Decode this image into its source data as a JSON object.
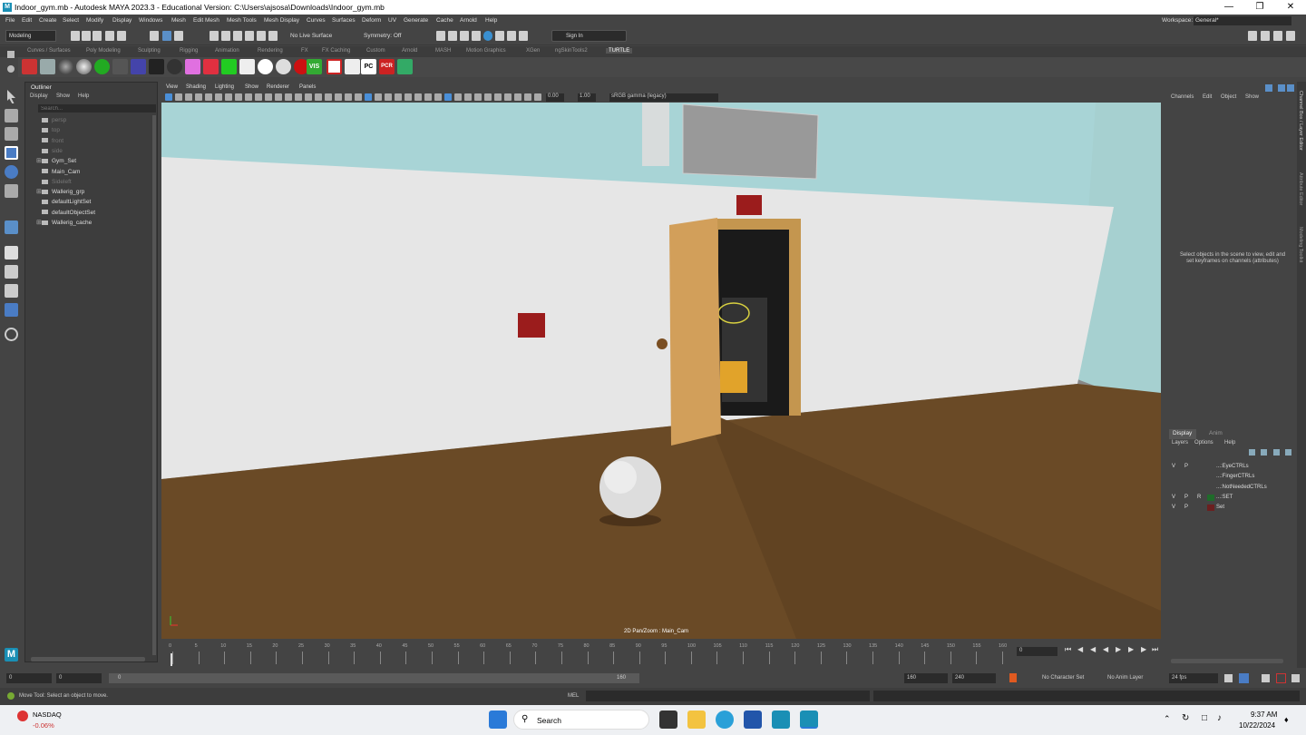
{
  "window": {
    "title": "Indoor_gym.mb - Autodesk MAYA 2023.3 - Educational Version: C:\\Users\\ajsosa\\Downloads\\Indoor_gym.mb"
  },
  "menu": [
    "File",
    "Edit",
    "Create",
    "Select",
    "Modify",
    "Display",
    "Windows",
    "Mesh",
    "Edit Mesh",
    "Mesh Tools",
    "Mesh Display",
    "Curves",
    "Surfaces",
    "Deform",
    "UV",
    "Generate",
    "Cache",
    "Arnold",
    "Help"
  ],
  "workspace": {
    "label": "Workspace:",
    "value": "General*"
  },
  "status": {
    "mode": "Modeling",
    "live_surface": "No Live Surface",
    "symmetry": "Symmetry: Off",
    "sign_in": "Sign In"
  },
  "shelf_tabs": [
    "Curves / Surfaces",
    "Poly Modeling",
    "Sculpting",
    "Rigging",
    "Animation",
    "Rendering",
    "FX",
    "FX Caching",
    "Custom",
    "Arnold",
    "MASH",
    "Motion Graphics",
    "XGen",
    "ngSkinTools2",
    "TURTLE"
  ],
  "shelf_text": {
    "vis": "VIS",
    "pc": "PC",
    "pcr": "PCR"
  },
  "outliner": {
    "title": "Outliner",
    "menus": [
      "Display",
      "Show",
      "Help"
    ],
    "search_placeholder": "Search...",
    "items": [
      {
        "label": "persp",
        "dim": true,
        "expand": false
      },
      {
        "label": "top",
        "dim": true,
        "expand": false
      },
      {
        "label": "front",
        "dim": true,
        "expand": false
      },
      {
        "label": "side",
        "dim": true,
        "expand": false
      },
      {
        "label": "Gym_Set",
        "dim": false,
        "expand": true
      },
      {
        "label": "Main_Cam",
        "dim": false,
        "expand": false
      },
      {
        "label": "Sideleft",
        "dim": true,
        "expand": false
      },
      {
        "label": "Wallerig_grp",
        "dim": false,
        "expand": true
      },
      {
        "label": "defaultLightSet",
        "dim": false,
        "expand": false
      },
      {
        "label": "defaultObjectSet",
        "dim": false,
        "expand": false
      },
      {
        "label": "Wallerig_cache",
        "dim": false,
        "expand": true
      }
    ]
  },
  "viewport": {
    "menus": [
      "View",
      "Shading",
      "Lighting",
      "Show",
      "Renderer",
      "Panels"
    ],
    "exposure": "0.00",
    "gamma": "1.00",
    "colorspace": "sRGB gamma (legacy)",
    "hud": "2D Pan/Zoom : Main_Cam"
  },
  "channel_box": {
    "menus": [
      "Channels",
      "Edit",
      "Object",
      "Show"
    ],
    "hint": "Select objects in the scene to view, edit and set keyframes on channels (attributes)"
  },
  "right_tabs": [
    "Channel Box / Layer Editor",
    "Attribute Editor",
    "Modeling Toolkit"
  ],
  "layers": {
    "tabs": [
      "Display",
      "Anim"
    ],
    "menus": [
      "Layers",
      "Options",
      "Help"
    ],
    "rows": [
      {
        "v": "V",
        "p": "P",
        "r": "",
        "name": "...:EyeCTRLs",
        "color": ""
      },
      {
        "v": "",
        "p": "",
        "r": "",
        "name": "...:FingerCTRLs",
        "color": ""
      },
      {
        "v": "",
        "p": "",
        "r": "",
        "name": "...:NotNeededCTRLs",
        "color": ""
      },
      {
        "v": "V",
        "p": "P",
        "r": "R",
        "name": "...:SET",
        "color": "#1f6b2a"
      },
      {
        "v": "V",
        "p": "P",
        "r": "",
        "name": "Set",
        "color": "#6b1f1f"
      }
    ]
  },
  "timeline": {
    "ticks": [
      "0",
      "5",
      "10",
      "15",
      "20",
      "25",
      "30",
      "35",
      "40",
      "45",
      "50",
      "55",
      "60",
      "65",
      "70",
      "75",
      "80",
      "85",
      "90",
      "95",
      "100",
      "105",
      "110",
      "115",
      "120",
      "125",
      "130",
      "135",
      "140",
      "145",
      "150",
      "155",
      "160"
    ],
    "current_frame": "0"
  },
  "range": {
    "start": "0",
    "anim_start": "0",
    "slider_start": "0",
    "slider_end": "160",
    "end": "160",
    "anim_end": "240",
    "character_set": "No Character Set",
    "anim_layer": "No Anim Layer",
    "fps": "24 fps"
  },
  "cmd": {
    "lang": "MEL",
    "help": "Move Tool: Select an object to move."
  },
  "taskbar": {
    "stock_name": "NASDAQ",
    "stock_change": "-0.06%",
    "search": "Search",
    "time": "9:37 AM",
    "date": "10/22/2024"
  }
}
